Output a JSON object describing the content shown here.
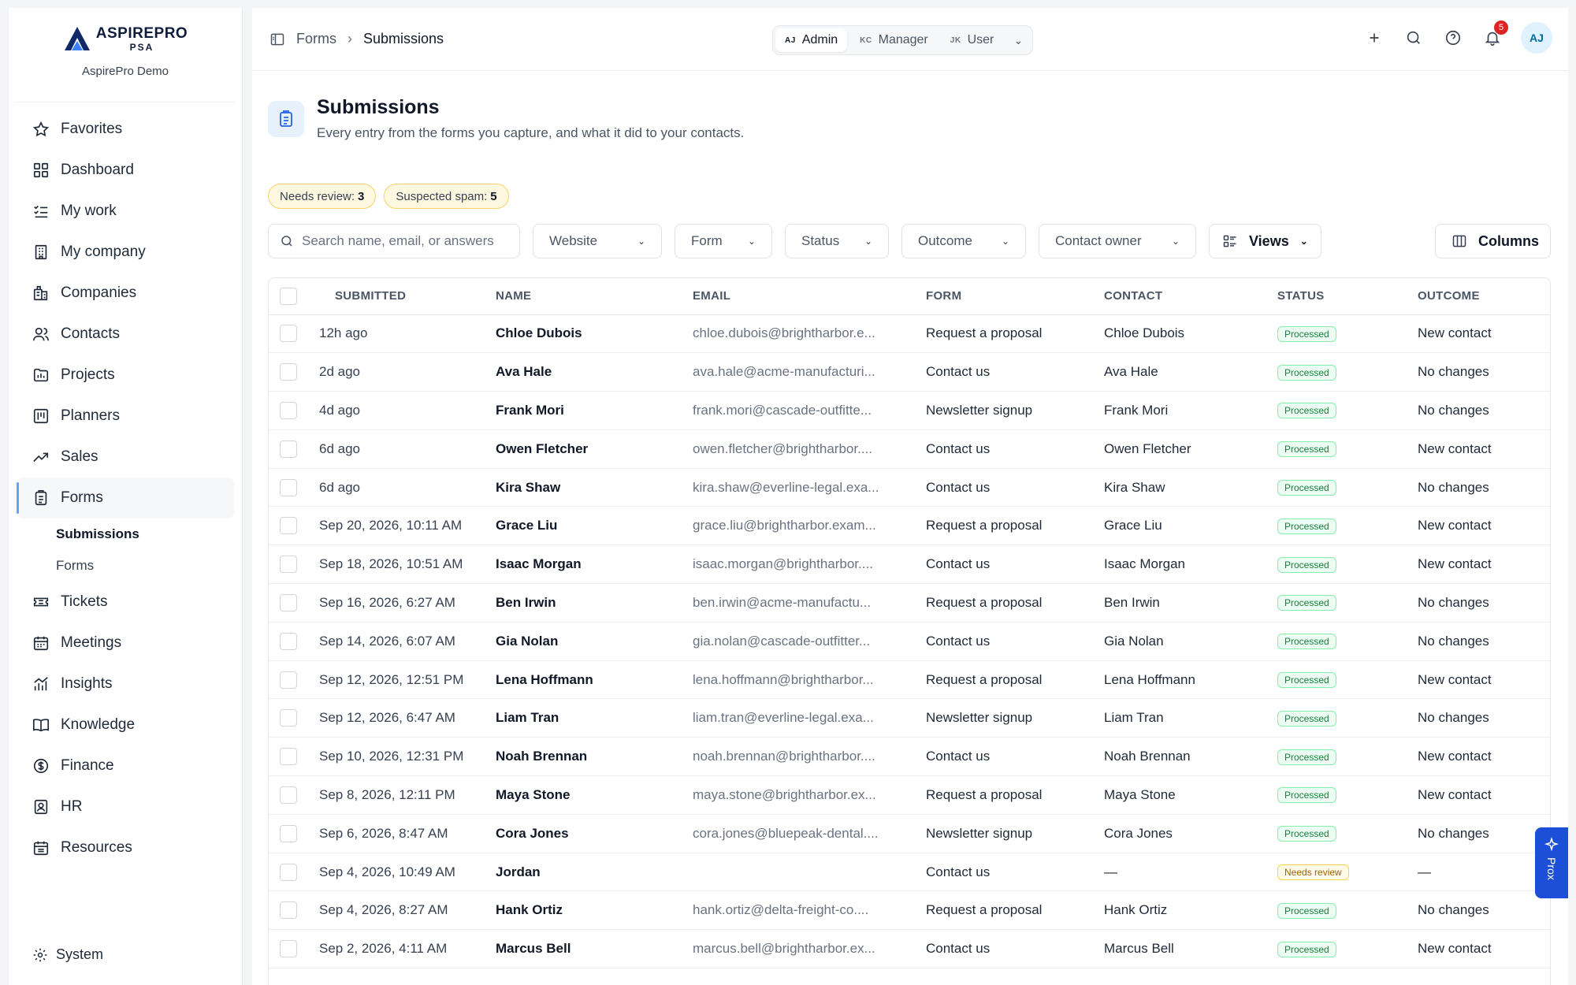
{
  "brand": {
    "name": "ASPIREPRO",
    "sub": "PSA",
    "org": "AspirePro Demo"
  },
  "nav": {
    "items": [
      {
        "label": "Favorites",
        "icon": "star-icon"
      },
      {
        "label": "Dashboard",
        "icon": "dashboard-icon"
      },
      {
        "label": "My work",
        "icon": "checklist-icon"
      },
      {
        "label": "My company",
        "icon": "building-icon"
      },
      {
        "label": "Companies",
        "icon": "buildings-icon"
      },
      {
        "label": "Contacts",
        "icon": "contacts-icon"
      },
      {
        "label": "Projects",
        "icon": "projects-icon"
      },
      {
        "label": "Planners",
        "icon": "planner-icon"
      },
      {
        "label": "Sales",
        "icon": "trend-icon"
      },
      {
        "label": "Forms",
        "icon": "clipboard-icon"
      }
    ],
    "sub_items": [
      {
        "label": "Submissions"
      },
      {
        "label": "Forms"
      }
    ],
    "items_after": [
      {
        "label": "Tickets",
        "icon": "ticket-icon"
      },
      {
        "label": "Meetings",
        "icon": "calendar-icon"
      },
      {
        "label": "Insights",
        "icon": "chart-icon"
      },
      {
        "label": "Knowledge",
        "icon": "book-icon"
      },
      {
        "label": "Finance",
        "icon": "dollar-icon"
      },
      {
        "label": "HR",
        "icon": "badge-icon"
      },
      {
        "label": "Resources",
        "icon": "calendar-grid-icon"
      }
    ],
    "system": "System"
  },
  "topbar": {
    "breadcrumb": [
      "Forms",
      "Submissions"
    ],
    "roles": [
      {
        "initials": "AJ",
        "label": "Admin"
      },
      {
        "initials": "KC",
        "label": "Manager"
      },
      {
        "initials": "JK",
        "label": "User"
      }
    ],
    "notifications": "5",
    "avatar": "AJ"
  },
  "page": {
    "title": "Submissions",
    "subtitle": "Every entry from the forms you capture, and what it did to your contacts."
  },
  "chips": [
    {
      "label": "Needs review:",
      "count": "3"
    },
    {
      "label": "Suspected spam:",
      "count": "5"
    }
  ],
  "filters": {
    "search_placeholder": "Search name, email, or answers",
    "selects": [
      "Website",
      "Form",
      "Status",
      "Outcome",
      "Contact owner"
    ],
    "views": "Views",
    "columns": "Columns"
  },
  "table": {
    "headers": [
      "SUBMITTED",
      "NAME",
      "EMAIL",
      "FORM",
      "CONTACT",
      "STATUS",
      "OUTCOME"
    ],
    "rows": [
      {
        "submitted": "12h ago",
        "name": "Chloe Dubois",
        "email": "chloe.dubois@brightharbor.e...",
        "form": "Request a proposal",
        "contact": "Chloe Dubois",
        "status": "Processed",
        "outcome": "New contact"
      },
      {
        "submitted": "2d ago",
        "name": "Ava Hale",
        "email": "ava.hale@acme-manufacturi...",
        "form": "Contact us",
        "contact": "Ava Hale",
        "status": "Processed",
        "outcome": "No changes"
      },
      {
        "submitted": "4d ago",
        "name": "Frank Mori",
        "email": "frank.mori@cascade-outfitte...",
        "form": "Newsletter signup",
        "contact": "Frank Mori",
        "status": "Processed",
        "outcome": "No changes"
      },
      {
        "submitted": "6d ago",
        "name": "Owen Fletcher",
        "email": "owen.fletcher@brightharbor....",
        "form": "Contact us",
        "contact": "Owen Fletcher",
        "status": "Processed",
        "outcome": "New contact"
      },
      {
        "submitted": "6d ago",
        "name": "Kira Shaw",
        "email": "kira.shaw@everline-legal.exa...",
        "form": "Contact us",
        "contact": "Kira Shaw",
        "status": "Processed",
        "outcome": "No changes"
      },
      {
        "submitted": "Sep 20, 2026, 10:11 AM",
        "name": "Grace Liu",
        "email": "grace.liu@brightharbor.exam...",
        "form": "Request a proposal",
        "contact": "Grace Liu",
        "status": "Processed",
        "outcome": "New contact"
      },
      {
        "submitted": "Sep 18, 2026, 10:51 AM",
        "name": "Isaac Morgan",
        "email": "isaac.morgan@brightharbor....",
        "form": "Contact us",
        "contact": "Isaac Morgan",
        "status": "Processed",
        "outcome": "New contact"
      },
      {
        "submitted": "Sep 16, 2026, 6:27 AM",
        "name": "Ben Irwin",
        "email": "ben.irwin@acme-manufactu...",
        "form": "Request a proposal",
        "contact": "Ben Irwin",
        "status": "Processed",
        "outcome": "No changes"
      },
      {
        "submitted": "Sep 14, 2026, 6:07 AM",
        "name": "Gia Nolan",
        "email": "gia.nolan@cascade-outfitter...",
        "form": "Contact us",
        "contact": "Gia Nolan",
        "status": "Processed",
        "outcome": "No changes"
      },
      {
        "submitted": "Sep 12, 2026, 12:51 PM",
        "name": "Lena Hoffmann",
        "email": "lena.hoffmann@brightharbor...",
        "form": "Request a proposal",
        "contact": "Lena Hoffmann",
        "status": "Processed",
        "outcome": "New contact"
      },
      {
        "submitted": "Sep 12, 2026, 6:47 AM",
        "name": "Liam Tran",
        "email": "liam.tran@everline-legal.exa...",
        "form": "Newsletter signup",
        "contact": "Liam Tran",
        "status": "Processed",
        "outcome": "No changes"
      },
      {
        "submitted": "Sep 10, 2026, 12:31 PM",
        "name": "Noah Brennan",
        "email": "noah.brennan@brightharbor....",
        "form": "Contact us",
        "contact": "Noah Brennan",
        "status": "Processed",
        "outcome": "New contact"
      },
      {
        "submitted": "Sep 8, 2026, 12:11 PM",
        "name": "Maya Stone",
        "email": "maya.stone@brightharbor.ex...",
        "form": "Request a proposal",
        "contact": "Maya Stone",
        "status": "Processed",
        "outcome": "New contact"
      },
      {
        "submitted": "Sep 6, 2026, 8:47 AM",
        "name": "Cora Jones",
        "email": "cora.jones@bluepeak-dental....",
        "form": "Newsletter signup",
        "contact": "Cora Jones",
        "status": "Processed",
        "outcome": "No changes"
      },
      {
        "submitted": "Sep 4, 2026, 10:49 AM",
        "name": "Jordan",
        "email": "",
        "form": "Contact us",
        "contact": "—",
        "status": "Needs review",
        "outcome": "—"
      },
      {
        "submitted": "Sep 4, 2026, 8:27 AM",
        "name": "Hank Ortiz",
        "email": "hank.ortiz@delta-freight-co....",
        "form": "Request a proposal",
        "contact": "Hank Ortiz",
        "status": "Processed",
        "outcome": "No changes"
      },
      {
        "submitted": "Sep 2, 2026, 4:11 AM",
        "name": "Marcus Bell",
        "email": "marcus.bell@brightharbor.ex...",
        "form": "Contact us",
        "contact": "Marcus Bell",
        "status": "Processed",
        "outcome": "New contact"
      }
    ]
  },
  "prox": {
    "label": "Prox"
  },
  "colors": {
    "accent": "#2563eb",
    "processed": "#15803d",
    "review": "#a16207",
    "badge": "#dc2626"
  }
}
